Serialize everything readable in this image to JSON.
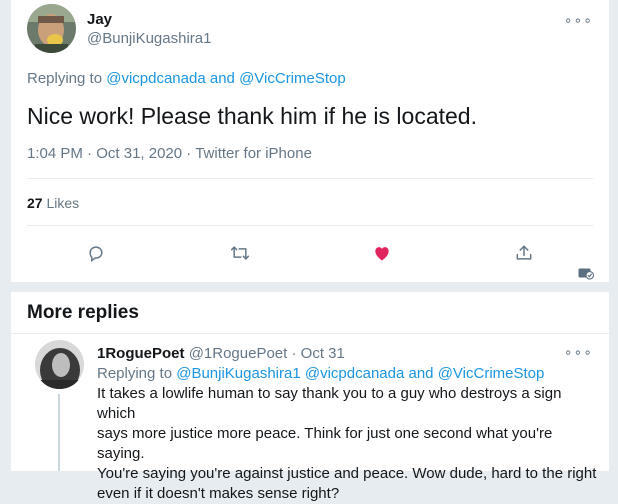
{
  "main_tweet": {
    "display_name": "Jay",
    "handle": "@BunjiKugashira1",
    "replying_prefix": "Replying to",
    "replying_to_1": "@vicpdcanada",
    "replying_and": "and",
    "replying_to_2": "@VicCrimeStop",
    "text": "Nice work! Please thank him if he is located.",
    "time": "1:04 PM",
    "date": "Oct 31, 2020",
    "sep": "·",
    "source": "Twitter for iPhone",
    "likes_count": "27",
    "likes_label": "Likes",
    "more": "∘∘∘"
  },
  "more_replies": {
    "heading": "More replies"
  },
  "reply": {
    "display_name": "1RoguePoet",
    "handle": "@1RoguePoet",
    "sep": "·",
    "date": "Oct 31",
    "replying_prefix": "Replying to",
    "replying_to_1": "@BunjiKugashira1",
    "replying_to_2": "@vicpdcanada",
    "replying_and": "and",
    "replying_to_3": "@VicCrimeStop",
    "text_lines": [
      "It takes a lowlife human to say thank you to a guy who destroys a sign which",
      "says more justice more peace. Think for just one second what you're saying.",
      "You're saying you're against justice and peace. Wow dude, hard to the right",
      "even if it doesn't makes sense right?"
    ],
    "more": "∘∘∘"
  },
  "colors": {
    "accent": "#1b95e0",
    "like_active": "#e0245e",
    "muted": "#657786",
    "background": "#e6ecf0"
  },
  "icons": [
    "reply-icon",
    "retweet-icon",
    "like-icon",
    "share-icon",
    "analytics-icon",
    "more-icon"
  ]
}
